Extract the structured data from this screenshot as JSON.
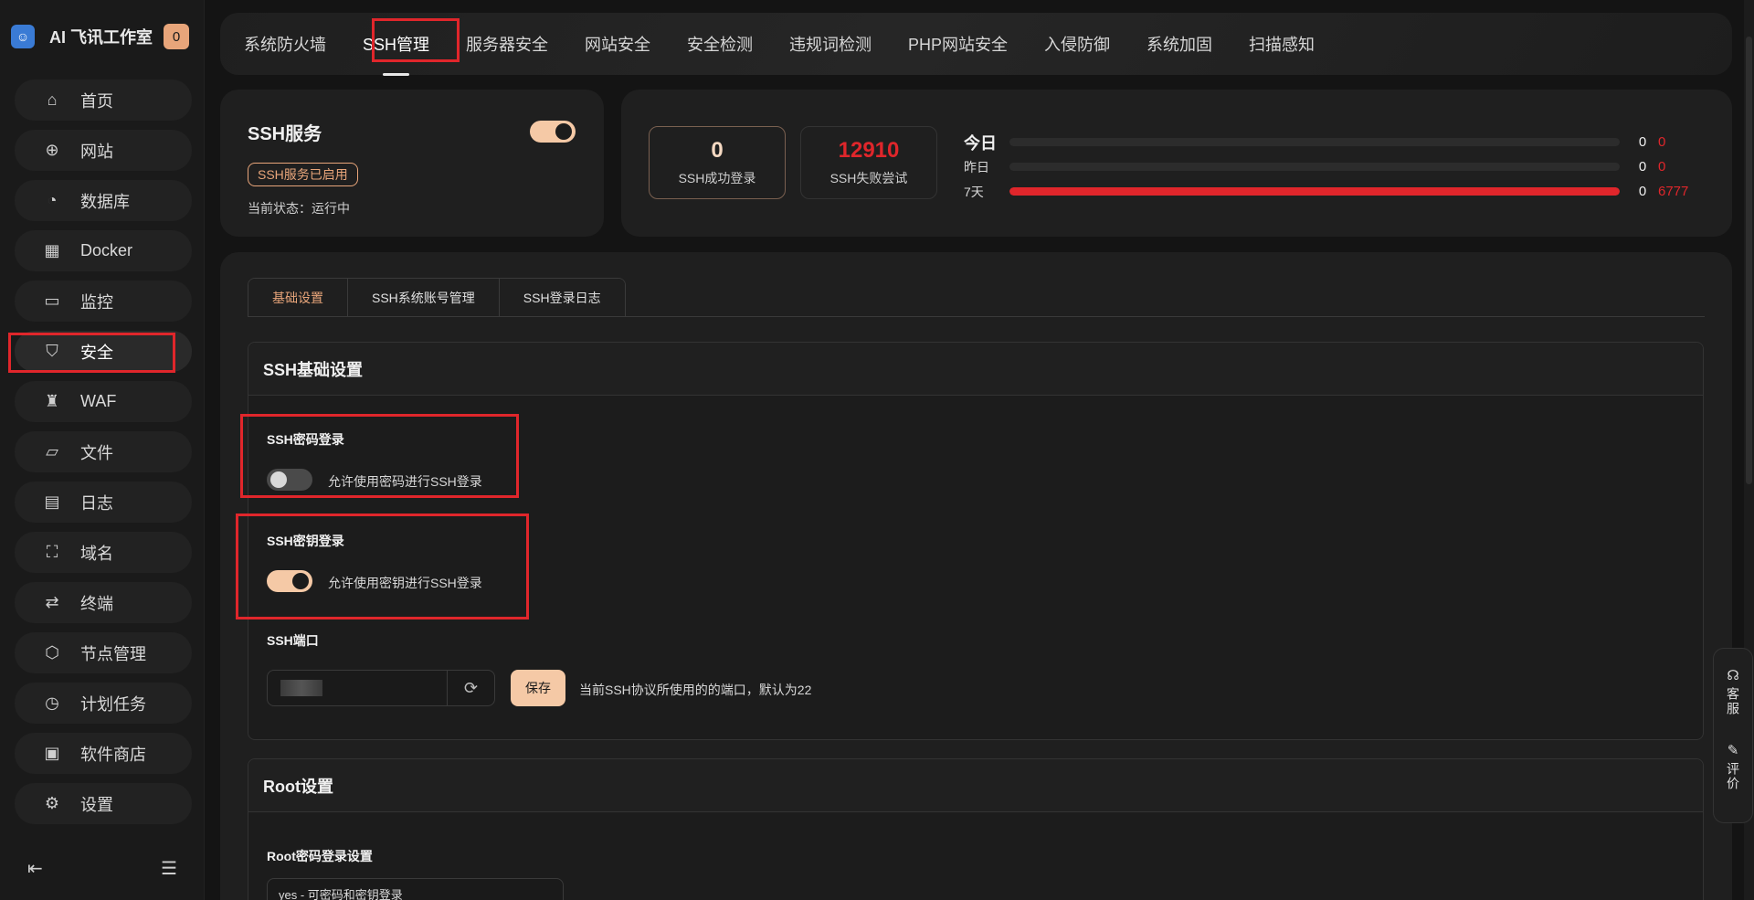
{
  "brand": {
    "name": "AI 飞讯工作室",
    "badge": "0"
  },
  "sidebar": {
    "items": [
      {
        "label": "首页",
        "icon": "home-icon",
        "glyph": "⌂"
      },
      {
        "label": "网站",
        "icon": "globe-icon",
        "glyph": "⊕"
      },
      {
        "label": "数据库",
        "icon": "database-icon",
        "glyph": "◔"
      },
      {
        "label": "Docker",
        "icon": "docker-icon",
        "glyph": "▦"
      },
      {
        "label": "监控",
        "icon": "monitor-icon",
        "glyph": "▭"
      },
      {
        "label": "安全",
        "icon": "shield-icon",
        "glyph": "⛉"
      },
      {
        "label": "WAF",
        "icon": "waf-icon",
        "glyph": "♜"
      },
      {
        "label": "文件",
        "icon": "folder-icon",
        "glyph": "▱"
      },
      {
        "label": "日志",
        "icon": "log-icon",
        "glyph": "▤"
      },
      {
        "label": "域名",
        "icon": "domain-icon",
        "glyph": "⛶"
      },
      {
        "label": "终端",
        "icon": "terminal-icon",
        "glyph": "⇄"
      },
      {
        "label": "节点管理",
        "icon": "node-icon",
        "glyph": "⬡"
      },
      {
        "label": "计划任务",
        "icon": "clock-icon",
        "glyph": "◷"
      },
      {
        "label": "软件商店",
        "icon": "store-icon",
        "glyph": "▣"
      },
      {
        "label": "设置",
        "icon": "settings-icon",
        "glyph": "⚙"
      }
    ]
  },
  "tabs": [
    "系统防火墙",
    "SSH管理",
    "服务器安全",
    "网站安全",
    "安全检测",
    "违规词检测",
    "PHP网站安全",
    "入侵防御",
    "系统加固",
    "扫描感知"
  ],
  "ssh_service": {
    "title": "SSH服务",
    "enabled": true,
    "pill": "SSH服务已启用",
    "status": "当前状态：运行中"
  },
  "stats": {
    "success_count": "0",
    "success_label": "SSH成功登录",
    "fail_count": "12910",
    "fail_label": "SSH失败尝试",
    "rows": [
      {
        "label": "今日",
        "ok": "0",
        "fail": "0",
        "fill_fraction": 0
      },
      {
        "label": "昨日",
        "ok": "0",
        "fail": "0",
        "fill_fraction": 0
      },
      {
        "label": "7天",
        "ok": "0",
        "fail": "6777",
        "fill_fraction": 1
      }
    ]
  },
  "subtabs": [
    "基础设置",
    "SSH系统账号管理",
    "SSH登录日志"
  ],
  "basic": {
    "header": "SSH基础设置",
    "password_login": {
      "title": "SSH密码登录",
      "desc": "允许使用密码进行SSH登录",
      "enabled": false
    },
    "key_login": {
      "title": "SSH密钥登录",
      "desc": "允许使用密钥进行SSH登录",
      "enabled": true
    },
    "port": {
      "title": "SSH端口",
      "save": "保存",
      "hint": "当前SSH协议所使用的的端口，默认为22"
    }
  },
  "root": {
    "header": "Root设置",
    "pw_title": "Root密码登录设置",
    "select_value": "yes - 可密码和密钥登录"
  },
  "float": {
    "service": "客服",
    "review": "评价"
  },
  "colors": {
    "accent": "#f5c9a6",
    "danger": "#e0262b",
    "highlight_box": "#e0262b"
  }
}
